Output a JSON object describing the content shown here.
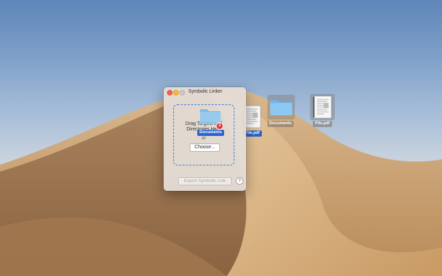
{
  "window": {
    "title": "Symbolic Linker",
    "drop_text": "Drag Targets and Directories Here",
    "or_text": "or",
    "choose_label": "Choose...",
    "export_label": "Export Symbolic Link",
    "help_label": "?"
  },
  "drag": {
    "badge_count": "2",
    "label": "Documents"
  },
  "desktop_icons": [
    {
      "label": "File.pdf",
      "icon": "pdf-document-icon",
      "selected": true
    },
    {
      "label": "Documents",
      "icon": "folder-icon",
      "selected": false
    },
    {
      "label": "File.pdf",
      "icon": "pdf-document-icon",
      "selected": false
    }
  ]
}
